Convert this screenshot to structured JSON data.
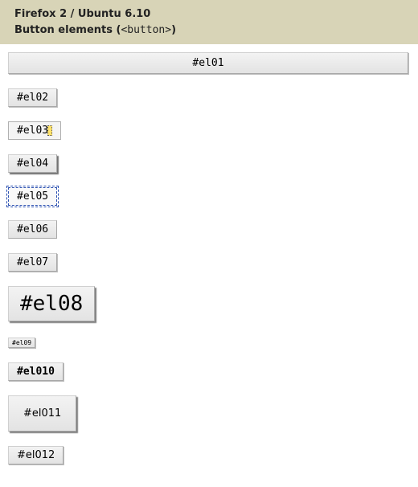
{
  "header": {
    "env_line": "Firefox 2 / Ubuntu 6.10",
    "title_prefix": "Button elements (",
    "title_code": "<button>",
    "title_suffix": ")"
  },
  "buttons": {
    "el01": "#el01",
    "el02": "#el02",
    "el03": "#el03",
    "el04": "#el04",
    "el05": "#el05",
    "el06": "#el06",
    "el07": "#el07",
    "el08": "#el08",
    "el09": "#el09",
    "el010": "#el010",
    "el011": "#el011",
    "el012": "#el012"
  }
}
